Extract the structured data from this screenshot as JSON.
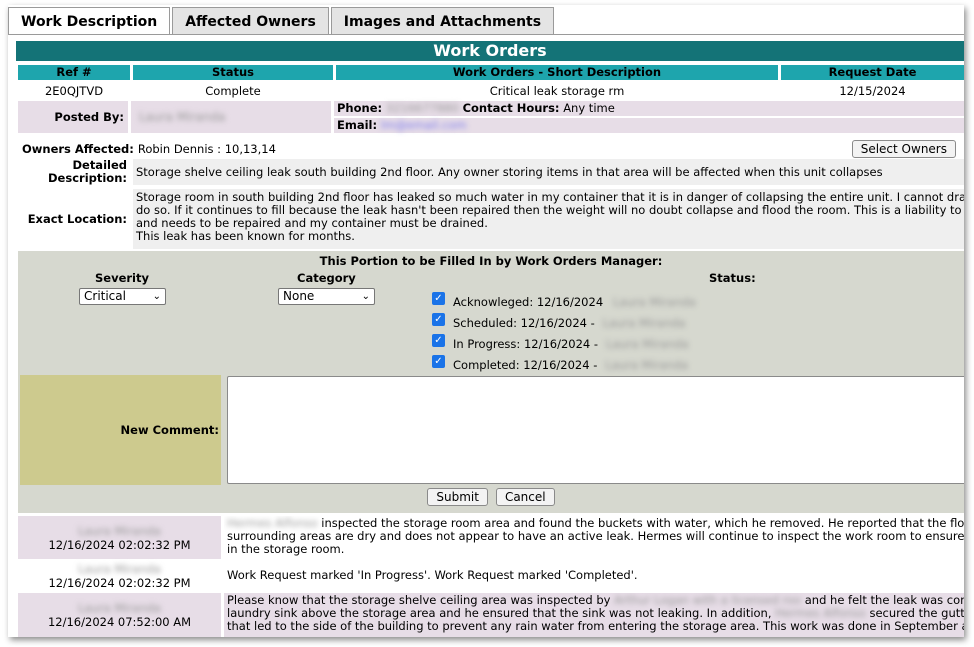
{
  "tabs": [
    {
      "label": "Work Description",
      "active": true
    },
    {
      "label": "Affected Owners",
      "active": false
    },
    {
      "label": "Images and Attachments",
      "active": false
    }
  ],
  "title": "Work Orders",
  "header": {
    "ref_label": "Ref #",
    "status_label": "Status",
    "short_desc_label": "Work Orders - Short Description",
    "request_date_label": "Request Date"
  },
  "order": {
    "ref": "2E0QJTVD",
    "status": "Complete",
    "short_desc": "Critical leak storage rm",
    "request_date": "12/15/2024"
  },
  "posted": {
    "label": "Posted By:",
    "name": "Laura Miranda",
    "phone_label": "Phone:",
    "phone": "3216677880",
    "contact_hours_label": "Contact Hours:",
    "contact_hours": "Any time",
    "email_label": "Email:",
    "email": "lm@email.com"
  },
  "owners": {
    "label": "Owners Affected:",
    "value": "Robin Dennis : 10,13,14",
    "select_button": "Select Owners"
  },
  "detailed": {
    "label_line1": "Detailed",
    "label_line2": "Description:",
    "text": "Storage shelve ceiling leak south building 2nd floor. Any owner storing items in that area will be affected when this unit collapses"
  },
  "location": {
    "label": "Exact Location:",
    "text": "Storage room in south building 2nd floor has leaked so much water in my container that it is in danger of collapsing the entire unit. I cannot drain it\ndo so. If it continues to fill because the leak hasn't been repaired then the weight will no doubt collapse and flood the room. This is a liability to the\nand needs to be repaired and my container must be drained.\nThis leak has been known for months."
  },
  "manager": {
    "title": "This Portion to be Filled In by Work Orders Manager:",
    "severity_label": "Severity",
    "severity_value": "Critical",
    "category_label": "Category",
    "category_value": "None",
    "status_label": "Status:",
    "statuses": [
      {
        "text": "Acknowleged: 12/16/2024",
        "by": "Laura Miranda",
        "checked": true
      },
      {
        "text": "Scheduled: 12/16/2024 -",
        "by": "Laura Miranda",
        "checked": true
      },
      {
        "text": "In Progress: 12/16/2024 -",
        "by": "Laura Miranda",
        "checked": true
      },
      {
        "text": "Completed: 12/16/2024 -",
        "by": "Laura Miranda",
        "checked": true
      }
    ],
    "new_comment_label": "New Comment:",
    "submit": "Submit",
    "cancel": "Cancel"
  },
  "comments": [
    {
      "author": "Laura Miranda",
      "timestamp": "12/16/2024 02:02:32 PM",
      "inspector": "Hermes Alfonso",
      "text": "inspected the storage room area and found the buckets with water, which he removed. He reported that the floor ar\nsurrounding areas are dry and does not appear to have an active leak. Hermes will continue to inspect the work room to ensure the\nin the storage room."
    },
    {
      "author": "Laura Miranda",
      "timestamp": "12/16/2024 02:02:32 PM",
      "text": "Work Request marked 'In Progress'. Work Request marked 'Completed'."
    },
    {
      "author": "Laura Miranda",
      "timestamp": "12/16/2024 07:52:00 AM",
      "text_a": "Please know that the storage shelve ceiling area was inspected by",
      "blur_a": "Arthur Logan with a licensed roo",
      "text_b": "and he felt the leak was coming",
      "text_c": "laundry sink above the storage area and he ensured that the sink was not leaking. In addition,",
      "blur_c": "Hermes Alfonso",
      "text_d": "secured the gutters o",
      "text_e": "that led to the side of the building to prevent any rain water from entering the storage area. This work was done in September and"
    }
  ]
}
